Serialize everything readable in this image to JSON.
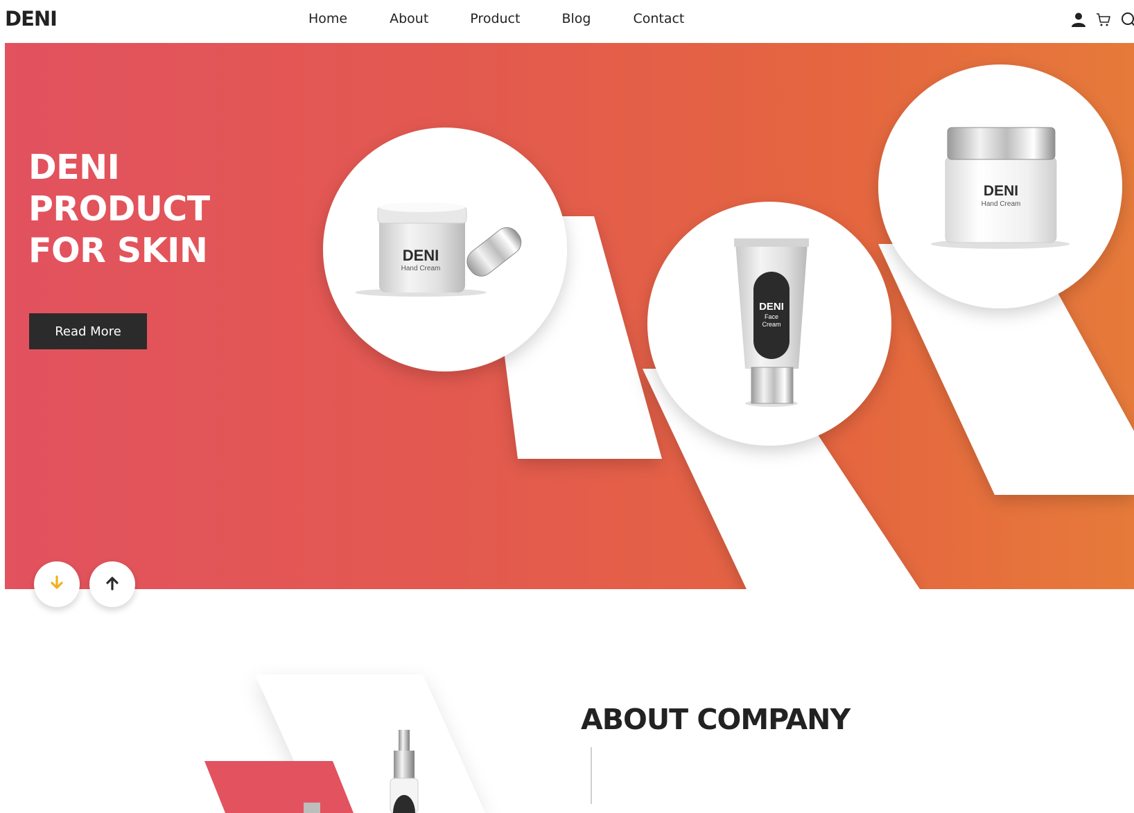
{
  "header": {
    "logo": "DENI",
    "nav": [
      "Home",
      "About",
      "Product",
      "Blog",
      "Contact"
    ],
    "icons": [
      "user-icon",
      "cart-icon",
      "search-icon"
    ]
  },
  "hero": {
    "title_lines": [
      "DENI",
      "PRODUCT",
      "FOR SKIN"
    ],
    "button_label": "Read More",
    "products": [
      {
        "brand": "DENI",
        "name": "Hand Cream",
        "type": "open-jar"
      },
      {
        "brand": "DENI",
        "name_line1": "Face",
        "name_line2": "Cream",
        "type": "tube"
      },
      {
        "brand": "DENI",
        "name": "Hand Cream",
        "type": "clear-jar"
      }
    ],
    "slider_buttons": [
      "arrow-down-icon",
      "arrow-up-icon"
    ]
  },
  "about": {
    "title": "ABOUT COMPANY"
  },
  "colors": {
    "gradient_start": "#e2525f",
    "gradient_end": "#e67a3a",
    "dark": "#2b2b2b",
    "arrow_yellow": "#f2b01e",
    "white": "#ffffff"
  }
}
